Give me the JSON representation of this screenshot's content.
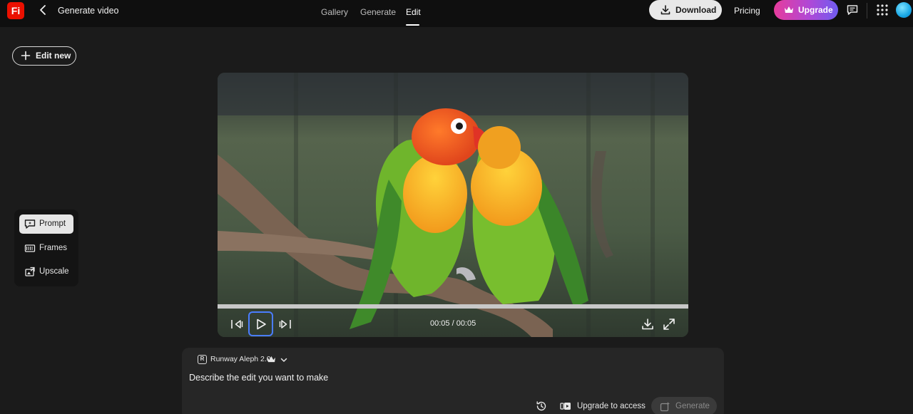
{
  "app": {
    "logo_text": "Fi",
    "page_title": "Generate video"
  },
  "nav": {
    "items": [
      "Gallery",
      "Generate",
      "Edit"
    ],
    "active": "Edit"
  },
  "header": {
    "download_label": "Download",
    "pricing_label": "Pricing",
    "upgrade_label": "Upgrade"
  },
  "sidebar": {
    "edit_new_label": "Edit new",
    "tools": [
      {
        "label": "Prompt",
        "icon": "prompt-icon",
        "active": true
      },
      {
        "label": "Frames",
        "icon": "frames-icon",
        "active": false
      },
      {
        "label": "Upscale",
        "icon": "upscale-icon",
        "active": false
      }
    ]
  },
  "player": {
    "time": "00:05 / 00:05",
    "progress": 1.0
  },
  "prompt": {
    "model_name": "Runway Aleph 2.0",
    "model_icon_text": "R",
    "placeholder": "Describe the edit you want to make",
    "upgrade_label": "Upgrade to access",
    "generate_label": "Generate"
  },
  "colors": {
    "brand": "#eb1000",
    "upgrade_start": "#e63c9c",
    "upgrade_end": "#6f5cf0",
    "focus": "#4a7dff"
  }
}
